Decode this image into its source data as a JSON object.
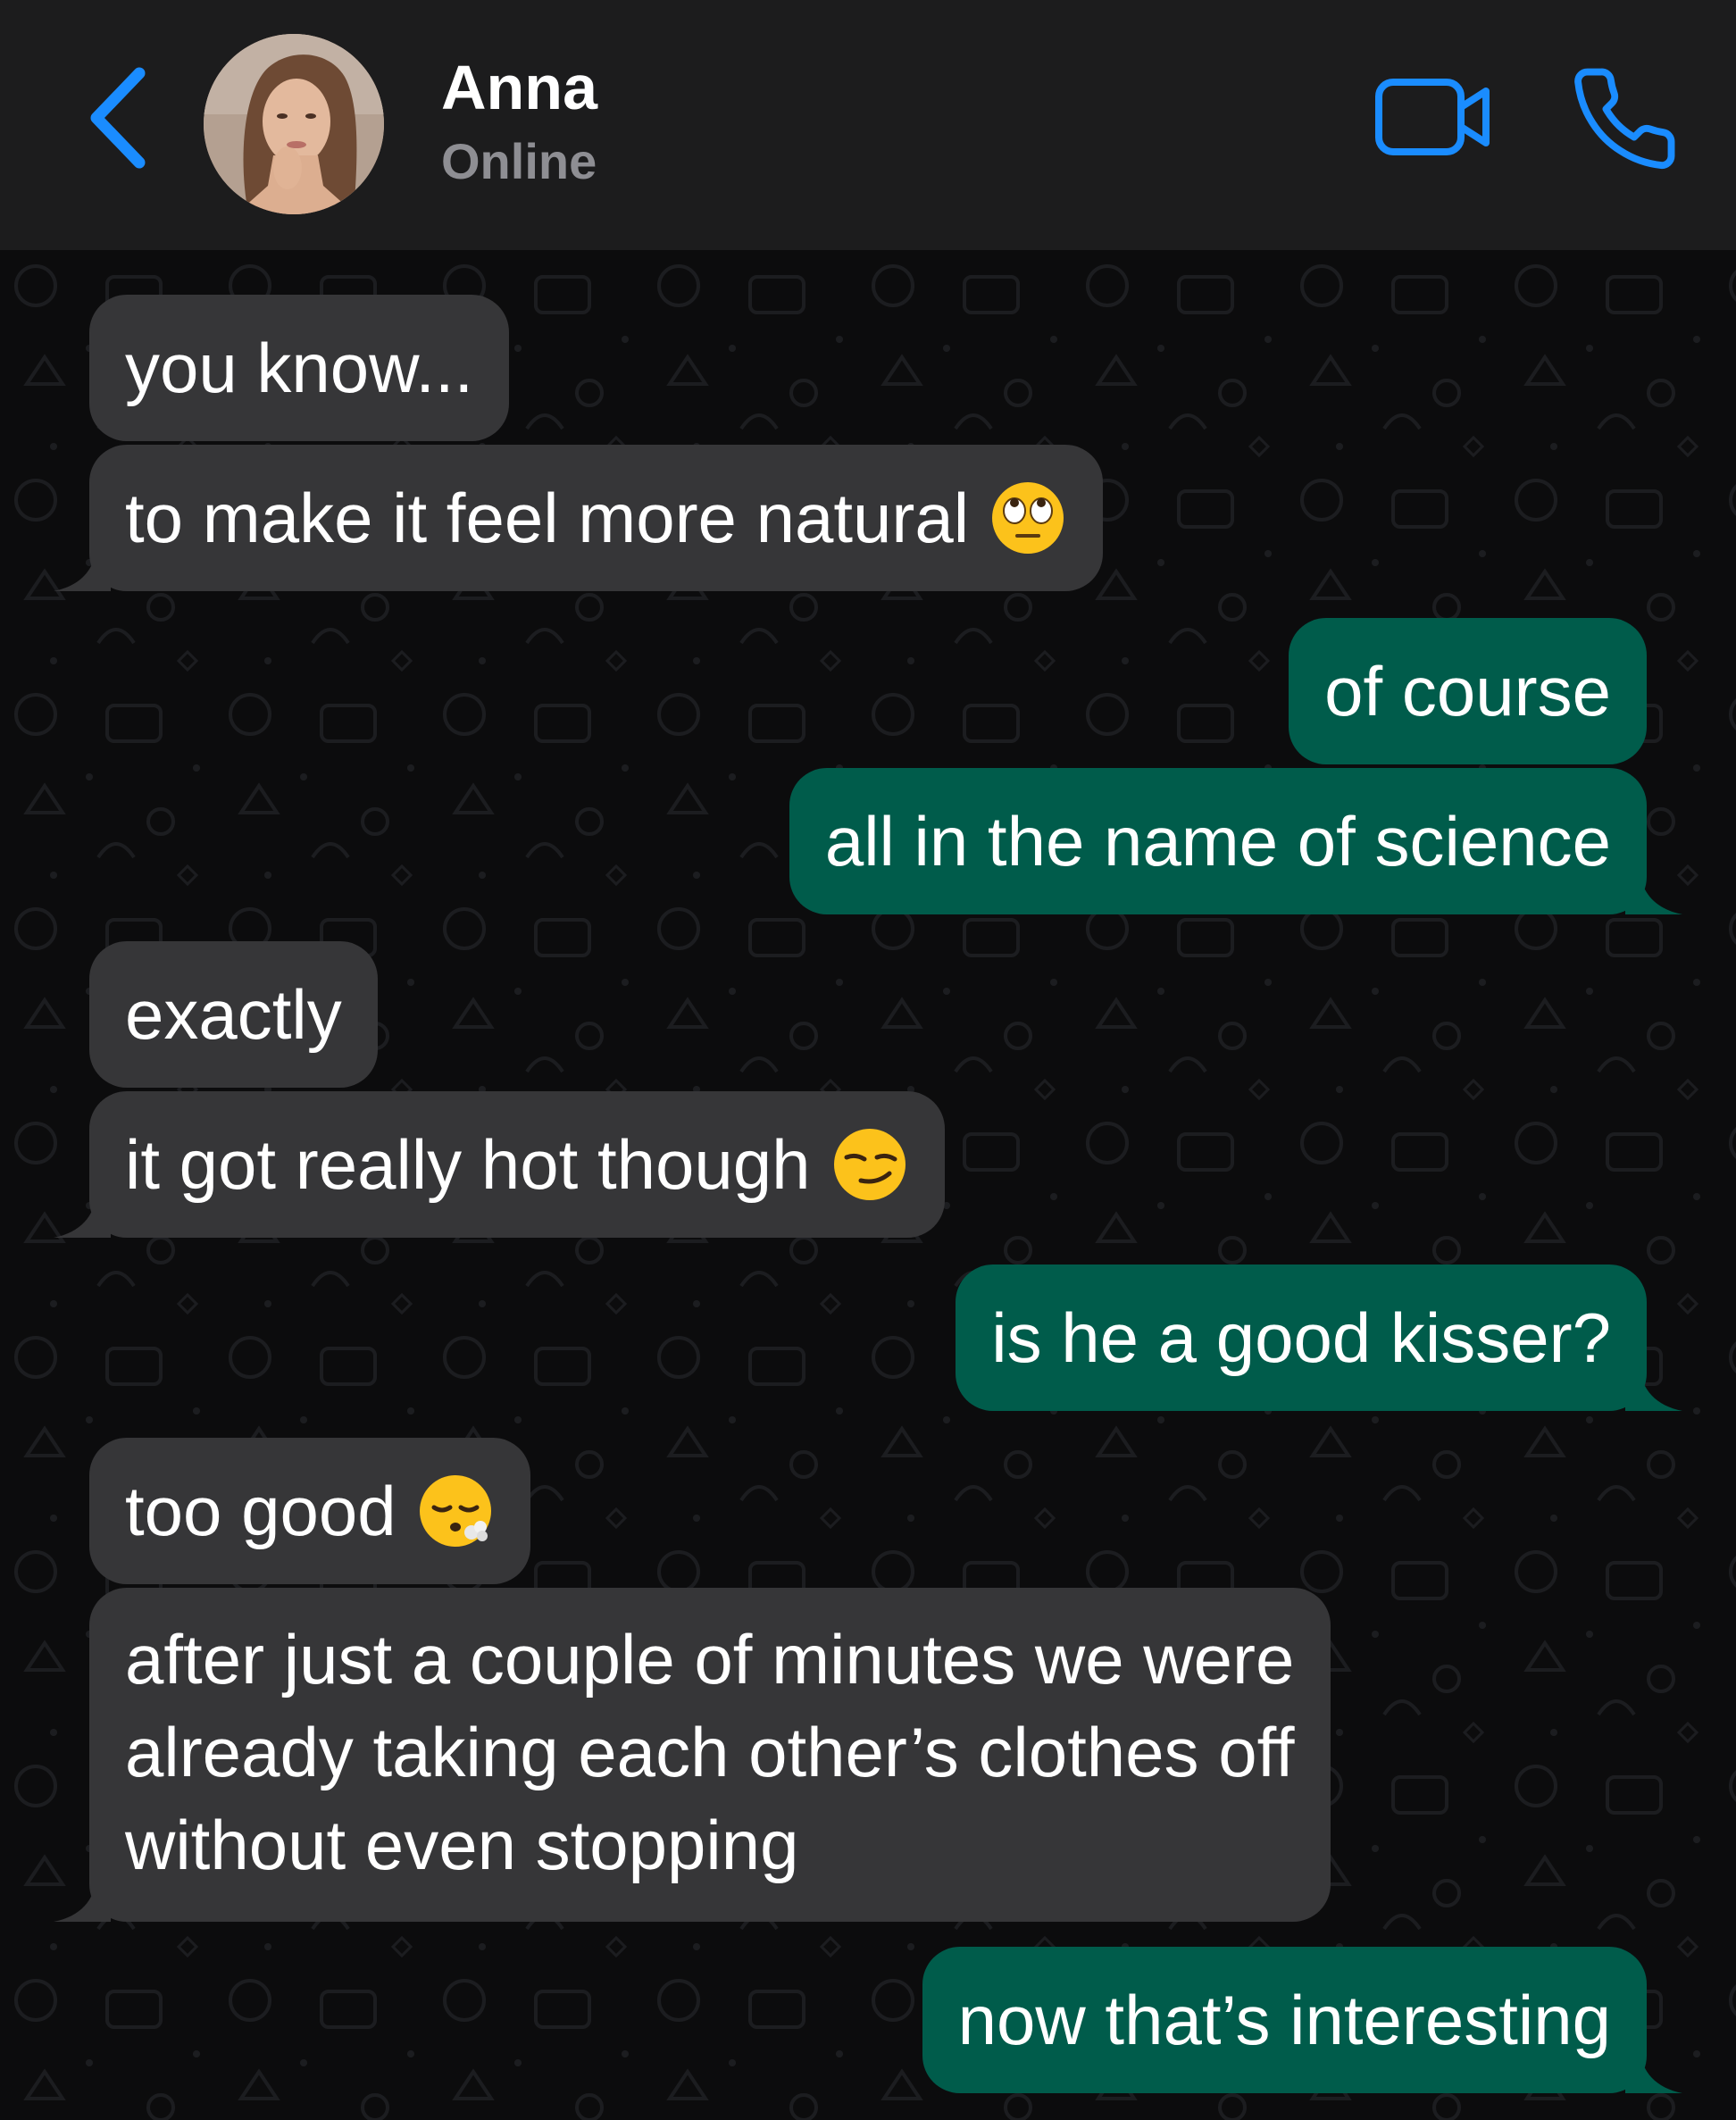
{
  "header": {
    "contact_name": "Anna",
    "contact_status": "Online"
  },
  "colors": {
    "header_bg": "#1c1c1d",
    "accent_blue": "#1a8cff",
    "incoming_bubble": "#363638",
    "outgoing_bubble": "#005c4b",
    "chat_bg": "#0c0c0d"
  },
  "icons": {
    "back": "chevron-left-icon",
    "video": "video-camera-icon",
    "call": "phone-icon"
  },
  "messages": [
    {
      "direction": "incoming",
      "text": "you know..."
    },
    {
      "direction": "incoming",
      "text": "to make it feel more natural",
      "emoji": "face-with-rolling-eyes"
    },
    {
      "direction": "outgoing",
      "text": "of course"
    },
    {
      "direction": "outgoing",
      "text": "all in the name of science"
    },
    {
      "direction": "incoming",
      "text": "exactly"
    },
    {
      "direction": "incoming",
      "text": "it got really hot though",
      "emoji": "smirking-face"
    },
    {
      "direction": "outgoing",
      "text": "is he a good kisser?"
    },
    {
      "direction": "incoming",
      "text": "too good",
      "emoji": "face-exhaling"
    },
    {
      "direction": "incoming",
      "lines": [
        "after just a couple of minutes we were",
        "already taking each other’s clothes off",
        "without even stopping"
      ]
    },
    {
      "direction": "outgoing",
      "text": "now that’s interesting"
    }
  ]
}
